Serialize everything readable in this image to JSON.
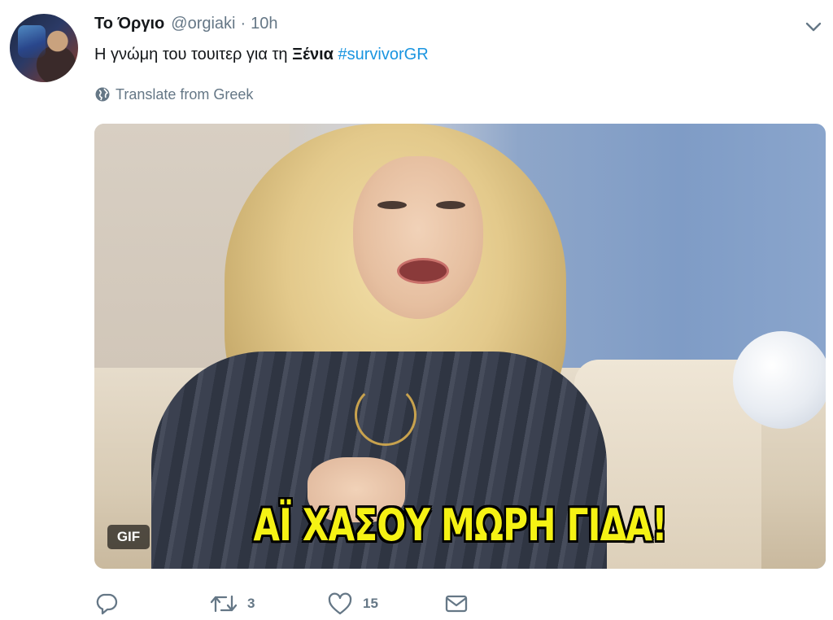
{
  "tweet": {
    "name": "Το Όργιο",
    "handle": "@orgiaki",
    "separator": "·",
    "time": "10h",
    "text_plain": "Η γνώμη του τουιτερ για τη ",
    "text_bold": "Ξένια",
    "text_hashtag": "#survivorGR",
    "translate_label": "Translate from Greek",
    "media": {
      "caption": "ΑΪ ΧΑΣΟΥ ΜΩΡΗ ΓΙΔΑ!",
      "badge": "GIF"
    },
    "actions": {
      "reply_count": "",
      "retweet_count": "3",
      "like_count": "15"
    }
  },
  "icons": {
    "caret": "chevron-down-icon",
    "translate": "globe-icon",
    "reply": "reply-icon",
    "retweet": "retweet-icon",
    "like": "heart-icon",
    "dm": "envelope-icon"
  },
  "colors": {
    "text": "#14171a",
    "secondary": "#657786",
    "link": "#1b95e0",
    "caption": "#f5f214"
  }
}
